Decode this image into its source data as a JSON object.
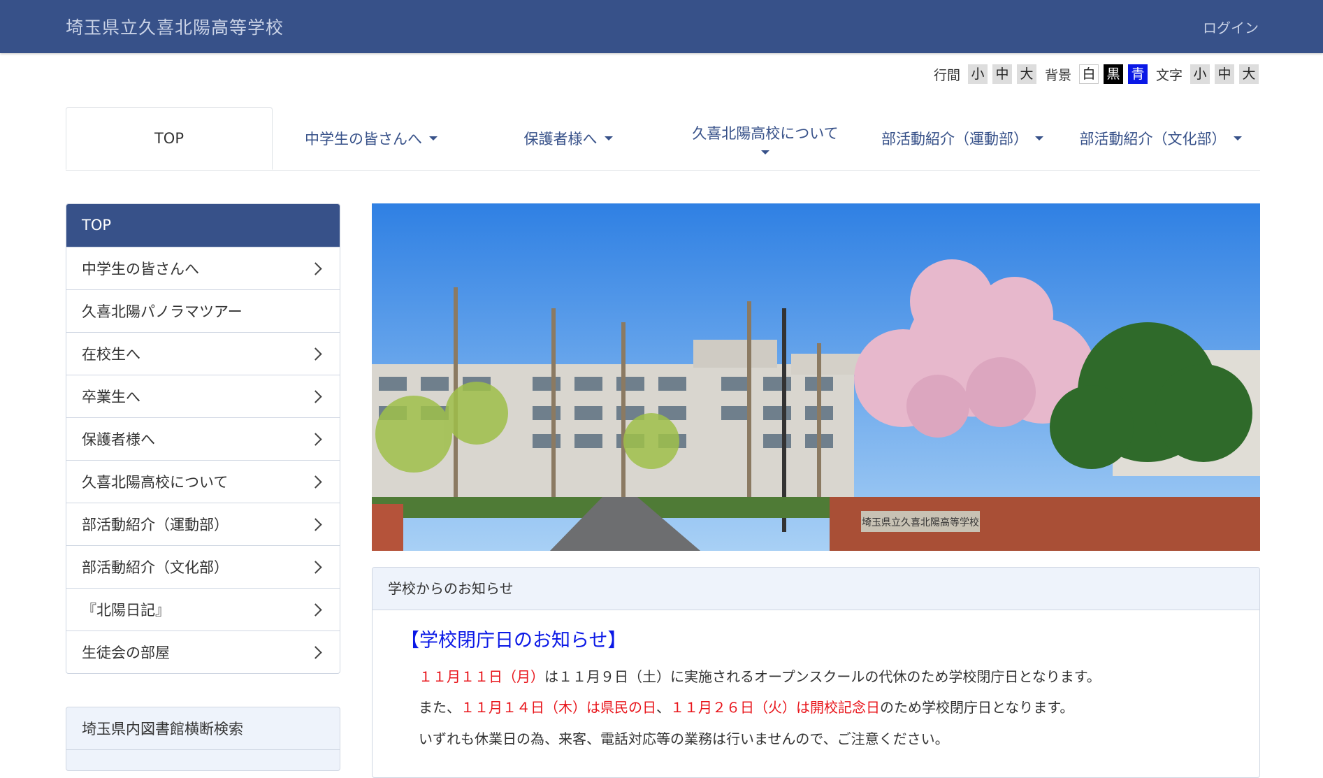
{
  "header": {
    "site_title": "埼玉県立久喜北陽高等学校",
    "login_label": "ログイン"
  },
  "accessibility": {
    "line_spacing_label": "行間",
    "line_spacing": [
      "小",
      "中",
      "大"
    ],
    "background_label": "背景",
    "background": [
      "白",
      "黒",
      "青"
    ],
    "font_size_label": "文字",
    "font_size": [
      "小",
      "中",
      "大"
    ]
  },
  "nav": {
    "tabs": [
      {
        "label": "TOP",
        "dropdown": false
      },
      {
        "label": "中学生の皆さんへ",
        "dropdown": true
      },
      {
        "label": "保護者様へ",
        "dropdown": true
      },
      {
        "label": "久喜北陽高校について",
        "dropdown": true
      },
      {
        "label": "部活動紹介（運動部）",
        "dropdown": true
      },
      {
        "label": "部活動紹介（文化部）",
        "dropdown": true
      }
    ]
  },
  "sidebar": {
    "title": "TOP",
    "items": [
      {
        "label": "中学生の皆さんへ",
        "chevron": true
      },
      {
        "label": "久喜北陽パノラマツアー",
        "chevron": false
      },
      {
        "label": "在校生へ",
        "chevron": true
      },
      {
        "label": "卒業生へ",
        "chevron": true
      },
      {
        "label": "保護者様へ",
        "chevron": true
      },
      {
        "label": "久喜北陽高校について",
        "chevron": true
      },
      {
        "label": "部活動紹介（運動部）",
        "chevron": true
      },
      {
        "label": "部活動紹介（文化部）",
        "chevron": true
      },
      {
        "label": "『北陽日記』",
        "chevron": true
      },
      {
        "label": "生徒会の部屋",
        "chevron": true
      }
    ],
    "library_title": "埼玉県内図書館横断検索"
  },
  "news": {
    "heading": "学校からのお知らせ",
    "title": "【学校閉庁日のお知らせ】",
    "line1_red": "１１月１１日（月）",
    "line1_rest": "は１１月９日（土）に実施されるオープンスクールの代休のため学校閉庁日となります。",
    "line2_a": "また、",
    "line2_red1": "１１月１４日（木）は県民の日",
    "line2_b": "、",
    "line2_red2": "１１月２６日（火）は開校記念日",
    "line2_c": "のため学校閉庁日となります。",
    "line3": "いずれも休業日の為、来客、電話対応等の業務は行いませんので、ご注意ください。"
  },
  "hero": {
    "sign_text": "埼玉県立久喜北陽高等学校"
  },
  "colors": {
    "brand": "#375189",
    "accent_blue": "#0a18e6",
    "alert_red": "#e8141a",
    "panel_bg": "#eef3fb"
  }
}
